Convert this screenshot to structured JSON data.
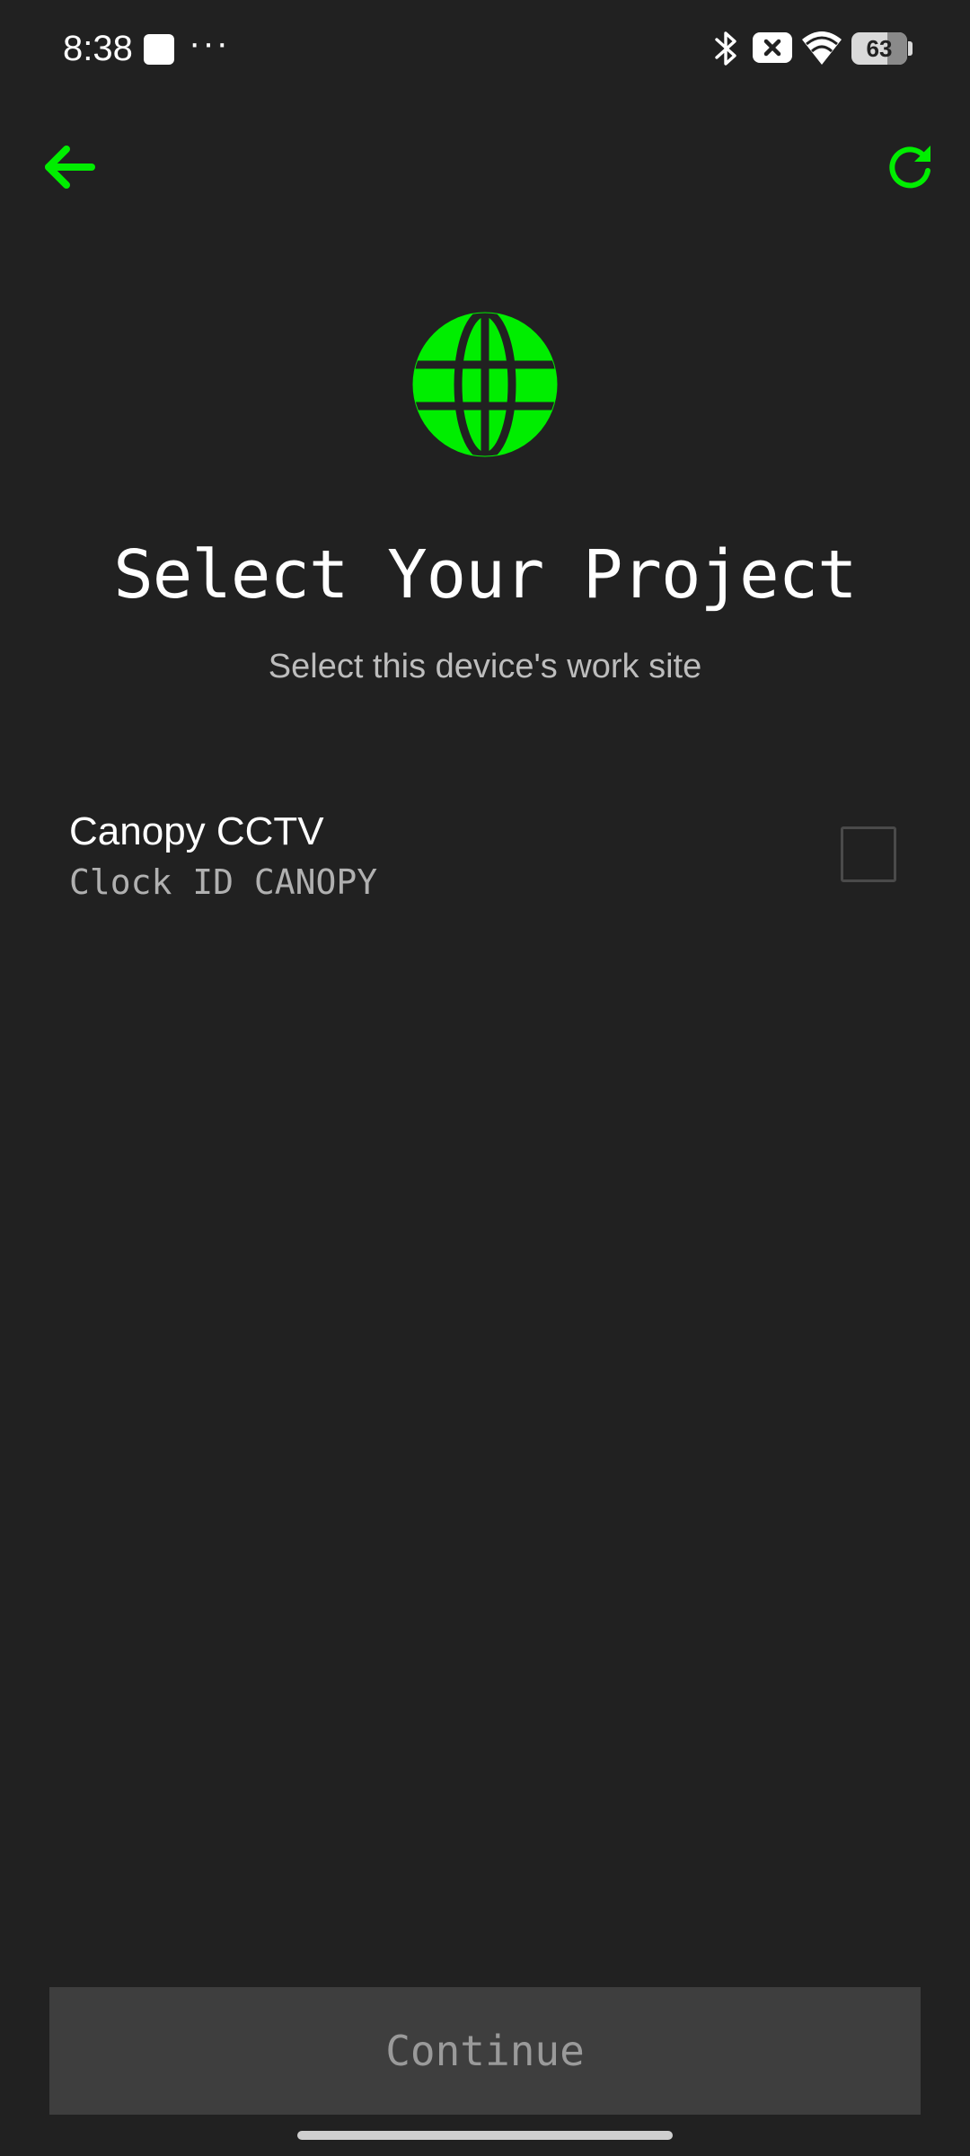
{
  "status_bar": {
    "time": "8:38",
    "more": "···",
    "battery_level": "63",
    "icons": [
      "notification-square-icon",
      "bluetooth-icon",
      "no-sim-icon",
      "wifi-icon",
      "battery-icon"
    ]
  },
  "app_bar": {
    "back_icon": "arrow-left-icon",
    "refresh_icon": "refresh-icon"
  },
  "header": {
    "icon": "globe-icon",
    "title": "Select Your Project",
    "subtitle": "Select this device's work site"
  },
  "projects": [
    {
      "name": "Canopy CCTV",
      "clock_id": "Clock ID CANOPY",
      "selected": false
    }
  ],
  "footer": {
    "continue_label": "Continue",
    "continue_enabled": false
  },
  "colors": {
    "background": "#212121",
    "accent": "#00ee00",
    "title": "#ffffff",
    "subtitle": "#bdbdbd",
    "button_disabled_bg": "#3e3e3e",
    "button_disabled_text": "#9a9a9a"
  }
}
